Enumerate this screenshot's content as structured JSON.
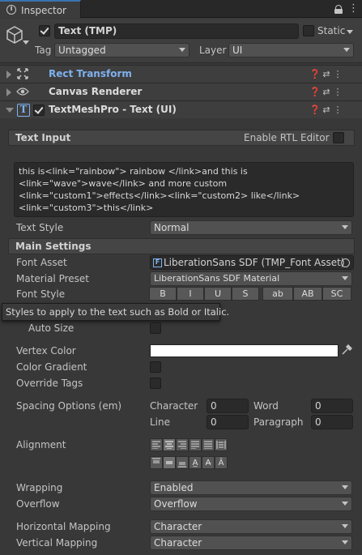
{
  "tab": {
    "title": "Inspector"
  },
  "gameobject": {
    "active": true,
    "name": "Text (TMP)",
    "static_label": "Static",
    "tag_label": "Tag",
    "tag_value": "Untagged",
    "layer_label": "Layer",
    "layer_value": "UI"
  },
  "components": {
    "rect_transform": "Rect Transform",
    "canvas_renderer": "Canvas Renderer",
    "tmp": "TextMeshPro - Text (UI)"
  },
  "text_input": {
    "section": "Text Input",
    "rtl_label": "Enable RTL Editor",
    "lines": [
      "this is<link=\"rainbow\"> rainbow </link>and this is",
      "<link=\"wave\">wave</link> and more custom",
      "<link=\"custom1\">effects</link><link=\"custom2> like</link>",
      "<link=\"custom3\">this</link>"
    ]
  },
  "text_style": {
    "label": "Text Style",
    "value": "Normal"
  },
  "main_settings": {
    "section": "Main Settings",
    "font_asset_label": "Font Asset",
    "font_asset_value": "LiberationSans SDF (TMP_Font Asset)",
    "material_label": "Material Preset",
    "material_value": "LiberationSans SDF Material",
    "font_style_label": "Font Style",
    "font_style_buttons": [
      "B",
      "I",
      "U",
      "S",
      "ab",
      "AB",
      "SC"
    ],
    "tooltip": "Styles to apply to the text such as Bold or Italic.",
    "auto_size_label": "Auto Size",
    "vertex_color_label": "Vertex Color",
    "vertex_color": "#ffffff",
    "color_gradient_label": "Color Gradient",
    "override_tags_label": "Override Tags",
    "spacing_label": "Spacing Options (em)",
    "character_label": "Character",
    "character_value": "0",
    "word_label": "Word",
    "word_value": "0",
    "line_label": "Line",
    "line_value": "0",
    "paragraph_label": "Paragraph",
    "paragraph_value": "0",
    "alignment_label": "Alignment",
    "wrapping_label": "Wrapping",
    "wrapping_value": "Enabled",
    "overflow_label": "Overflow",
    "overflow_value": "Overflow",
    "hmap_label": "Horizontal Mapping",
    "hmap_value": "Character",
    "vmap_label": "Vertical Mapping",
    "vmap_value": "Character"
  },
  "colors": {
    "accent": "#3a72b0",
    "link_blue": "#7fb1ef"
  }
}
